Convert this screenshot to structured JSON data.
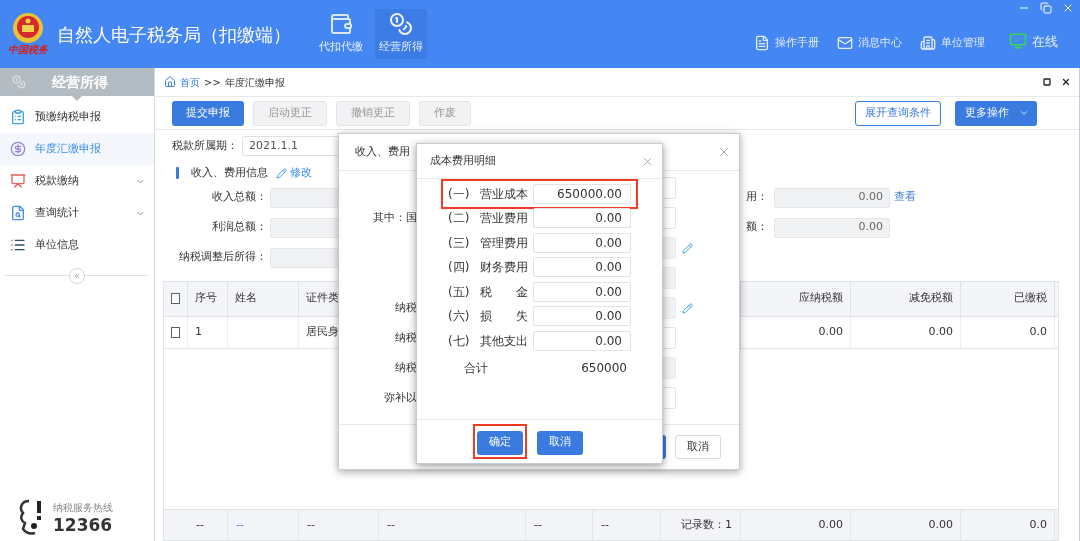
{
  "window": {
    "title": "自然人电子税务局（扣缴端）",
    "logo_caption": "中国税务"
  },
  "nav_tabs": [
    {
      "label": "代扣代缴",
      "kind": "wallet",
      "selected": false
    },
    {
      "label": "经营所得",
      "kind": "coins",
      "selected": true
    }
  ],
  "header_links": [
    {
      "label": "操作手册",
      "kind": "manual"
    },
    {
      "label": "消息中心",
      "kind": "mail"
    },
    {
      "label": "单位管理",
      "kind": "building"
    },
    {
      "label": "在线",
      "kind": "online"
    }
  ],
  "sidebar": {
    "title": "经营所得",
    "items": [
      {
        "label": "预缴纳税申报",
        "kind": "clipboard",
        "selected": false,
        "expandable": false
      },
      {
        "label": "年度汇缴申报",
        "kind": "yen",
        "selected": true,
        "expandable": false
      },
      {
        "label": "税款缴纳",
        "kind": "screen",
        "selected": false,
        "expandable": true
      },
      {
        "label": "查询统计",
        "kind": "query",
        "selected": false,
        "expandable": true
      },
      {
        "label": "单位信息",
        "kind": "list",
        "selected": false,
        "expandable": false
      }
    ],
    "collapse": "«",
    "hotline": {
      "label": "纳税服务热线",
      "number": "12366"
    }
  },
  "breadcrumb": {
    "home": "首页",
    "separator": ">>",
    "current": "年度汇缴申报"
  },
  "toolbar": {
    "buttons": [
      {
        "label": "提交申报",
        "disabled": false
      },
      {
        "label": "启动更正",
        "disabled": true
      },
      {
        "label": "撤销更正",
        "disabled": true
      },
      {
        "label": "作废",
        "disabled": true
      }
    ],
    "right_buttons": [
      {
        "label": "展开查询条件",
        "kind": "outline"
      },
      {
        "label": "更多操作",
        "kind": "dropdown"
      }
    ]
  },
  "form": {
    "period_label": "税款所属期：",
    "period_value": "2021.1.1",
    "section_title": "收入、费用信息",
    "edit_link": "修改",
    "rows": [
      {
        "label": "收入总额：",
        "right_label": "用：",
        "right_value": "0.00",
        "right_link": "查看"
      },
      {
        "label": "利润总额：",
        "right_label": "额：",
        "right_value": "0.00"
      },
      {
        "label": "纳税调整后所得："
      }
    ]
  },
  "table": {
    "header_checked": false,
    "columns": [
      "序号",
      "姓名",
      "证件类",
      "应纳税额",
      "减免税额",
      "已缴税"
    ],
    "rows": [
      {
        "checked": false,
        "index": "1",
        "id_type": "居民身",
        "tax_payable": "0.00",
        "tax_relief": "0.00",
        "tax_paid": "0.0"
      }
    ],
    "footer": {
      "cells": [
        {
          "text": "--",
          "link": false
        },
        {
          "text": "--",
          "link": true
        },
        {
          "text": "--",
          "link": false
        },
        {
          "text": "--",
          "link": false
        },
        {
          "text": "--",
          "link": false
        },
        {
          "text": "--",
          "link": false
        }
      ],
      "record_count": "记录数：1",
      "totals": [
        "0.00",
        "0.00",
        "0.0"
      ]
    }
  },
  "outer_dialog": {
    "title": "收入、费用",
    "cancel": "取消",
    "rows": [
      {
        "readonly": false,
        "editable": false
      },
      {
        "label": "其中：国",
        "readonly": false,
        "editable": false
      },
      {
        "readonly": true,
        "editable": true
      },
      {
        "readonly": true,
        "editable": false
      },
      {
        "label": "纳税",
        "readonly": true,
        "editable": true
      },
      {
        "label": "纳税",
        "readonly": false,
        "editable": false
      },
      {
        "label": "纳税",
        "readonly": true,
        "editable": false
      },
      {
        "label": "弥补以",
        "readonly": false,
        "editable": false
      }
    ]
  },
  "cost_dialog": {
    "title": "成本费用明细",
    "rows": [
      {
        "number": "(一)",
        "name": "营业成本",
        "value": "650000.00",
        "highlighted": true
      },
      {
        "number": "(二)",
        "name": "营业费用",
        "value": "0.00",
        "highlighted": false
      },
      {
        "number": "(三)",
        "name": "管理费用",
        "value": "0.00",
        "highlighted": false
      },
      {
        "number": "(四)",
        "name": "财务费用",
        "value": "0.00",
        "highlighted": false
      },
      {
        "number": "(五)",
        "name": "税　　金",
        "value": "0.00",
        "highlighted": false
      },
      {
        "number": "(六)",
        "name": "损　　失",
        "value": "0.00",
        "highlighted": false
      },
      {
        "number": "(七)",
        "name": "其他支出",
        "value": "0.00",
        "highlighted": false
      }
    ],
    "total_label": "合计",
    "total_value": "650000",
    "buttons": [
      {
        "label": "确定",
        "highlighted": true
      },
      {
        "label": "取消",
        "highlighted": false
      }
    ]
  }
}
